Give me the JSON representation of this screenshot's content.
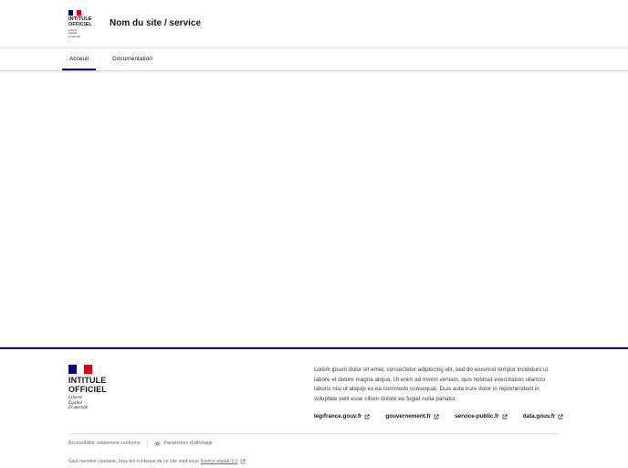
{
  "header": {
    "logo": {
      "line1": "INTITULE",
      "line2": "OFFICIEL",
      "motto": [
        "Liberté",
        "Égalité",
        "Fraternité"
      ]
    },
    "site_title": "Nom du site / service"
  },
  "nav": {
    "items": [
      {
        "label": "Acceuil",
        "active": true
      },
      {
        "label": "Documentation",
        "active": false
      }
    ]
  },
  "footer": {
    "logo": {
      "line1": "INTITULE",
      "line2": "OFFICIEL",
      "motto": [
        "Liberté",
        "Égalité",
        "Fraternité"
      ]
    },
    "description": "Lorem ipsum dolor sit amet, consectetur adipiscing elit, sed do eiusmod tempor incididunt ut labore et dolore magna aliqua. Ut enim ad minim veniam, quis nostrud exercitation ullamco laboris nisi ut aliquip ex ea commodo consequat. Duis aute irure dolor in reprehenderit in voluptate velit esse cillum dolore eu fugiat nulla pariatur.",
    "links": [
      "legifrance.gouv.fr",
      "gouvernement.fr",
      "service-public.fr",
      "data.gouv.fr"
    ],
    "bottom": {
      "accessibility": "Accessibilité: totalement conforme",
      "display_settings": "Paramètres d'affichage"
    },
    "license": {
      "prefix": "Sauf mention contraire, tous les contenus de ce site sont sous",
      "link": "licence etalab-2.0"
    }
  },
  "colors": {
    "primary": "#000091",
    "flag_red": "#e1000f",
    "text": "#161616",
    "muted": "#666666"
  },
  "icons": {
    "external_link": "external-link-icon",
    "settings": "display-settings-icon"
  }
}
